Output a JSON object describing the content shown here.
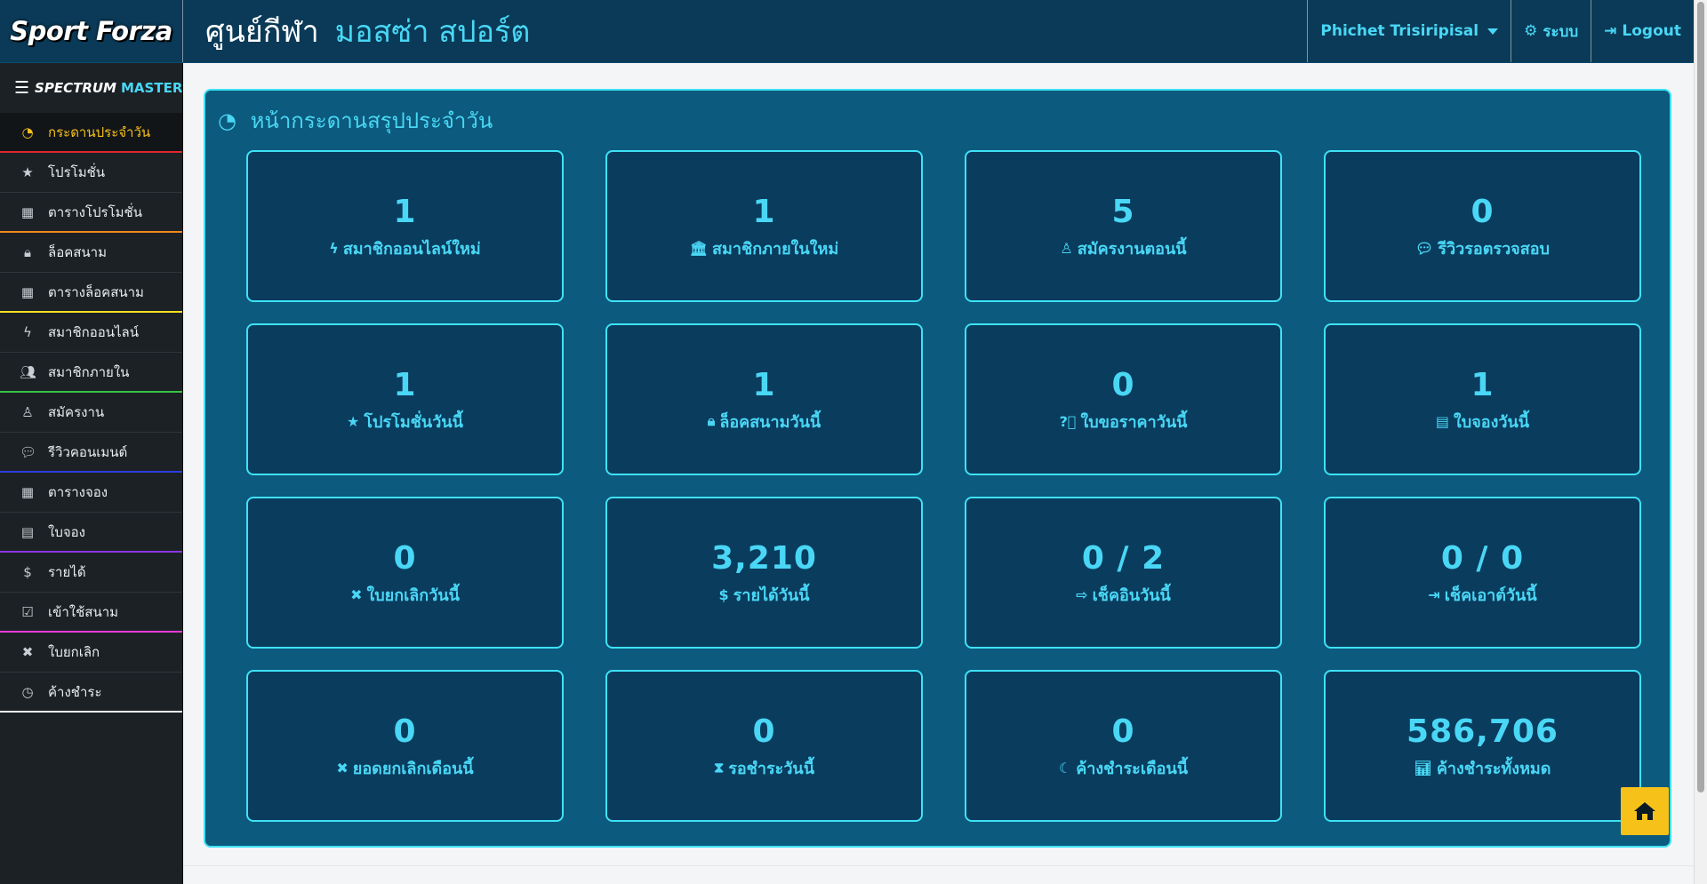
{
  "header": {
    "brand": "Sport Forza",
    "title_part1": "ศูนย์กีฬา",
    "title_part2": "มอสซ่า สปอร์ต",
    "user_name": "Phichet Trisiripisal",
    "system_label": "ระบบ",
    "logout_label": "Logout"
  },
  "sidebar": {
    "header_prefix": "SPECTRUM",
    "header_suffix": "MASTER",
    "items": [
      {
        "label": "กระดานประจำวัน",
        "icon": "dashboard-icon"
      },
      {
        "label": "โปรโมชั่น",
        "icon": "star-icon"
      },
      {
        "label": "ตารางโปรโมชั่น",
        "icon": "table-icon"
      },
      {
        "label": "ล็อคสนาม",
        "icon": "lock-icon"
      },
      {
        "label": "ตารางล็อคสนาม",
        "icon": "table-icon"
      },
      {
        "label": "สมาชิกออนไลน์",
        "icon": "bolt-icon"
      },
      {
        "label": "สมาชิกภายใน",
        "icon": "users-icon"
      },
      {
        "label": "สมัครงาน",
        "icon": "user-tie-icon"
      },
      {
        "label": "รีวิวคอนเมนต์",
        "icon": "comment-icon"
      },
      {
        "label": "ตารางจอง",
        "icon": "table-icon"
      },
      {
        "label": "ใบจอง",
        "icon": "book-icon"
      },
      {
        "label": "รายได้",
        "icon": "dollar-icon"
      },
      {
        "label": "เข้าใช้สนาม",
        "icon": "check-square-icon"
      },
      {
        "label": "ใบยกเลิก",
        "icon": "times-icon"
      },
      {
        "label": "ค้างชำระ",
        "icon": "clock-icon"
      }
    ]
  },
  "panel": {
    "title": "หน้ากระดานสรุปประจำวัน"
  },
  "cards": [
    {
      "value": "1",
      "label": "สมาชิกออนไลน์ใหม่",
      "icon": "bolt-icon"
    },
    {
      "value": "1",
      "label": "สมาชิกภายในใหม่",
      "icon": "bank-icon"
    },
    {
      "value": "5",
      "label": "สมัครงานตอนนี้",
      "icon": "user-tie-icon"
    },
    {
      "value": "0",
      "label": "รีวิวรอตรวจสอบ",
      "icon": "comment-icon"
    },
    {
      "value": "1",
      "label": "โปรโมชั่นวันนี้",
      "icon": "star-icon"
    },
    {
      "value": "1",
      "label": "ล็อคสนามวันนี้",
      "icon": "lock-icon"
    },
    {
      "value": "0",
      "label": "ใบขอราคาวันนี้",
      "icon": "question-circle-icon"
    },
    {
      "value": "1",
      "label": "ใบจองวันนี้",
      "icon": "book-icon"
    },
    {
      "value": "0",
      "label": "ใบยกเลิกวันนี้",
      "icon": "times-icon"
    },
    {
      "value": "3,210",
      "label": "รายได้วันนี้",
      "icon": "dollar-icon"
    },
    {
      "value": "0 / 2",
      "label": "เช็คอินวันนี้",
      "icon": "sign-in-icon"
    },
    {
      "value": "0 / 0",
      "label": "เช็คเอาต์วันนี้",
      "icon": "sign-out-icon"
    },
    {
      "value": "0",
      "label": "ยอดยกเลิกเดือนนี้",
      "icon": "times-icon"
    },
    {
      "value": "0",
      "label": "รอชำระวันนี้",
      "icon": "hourglass-icon"
    },
    {
      "value": "0",
      "label": "ค้างชำระเดือนนี้",
      "icon": "moon-icon"
    },
    {
      "value": "586,706",
      "label": "ค้างชำระทั้งหมด",
      "icon": "bar-chart-icon"
    }
  ],
  "colors": {
    "accent": "#49d7f5",
    "topbar": "#0a3a57",
    "panel": "#0c5a7d",
    "card": "#0a3c5e",
    "active": "#f6c21a"
  }
}
